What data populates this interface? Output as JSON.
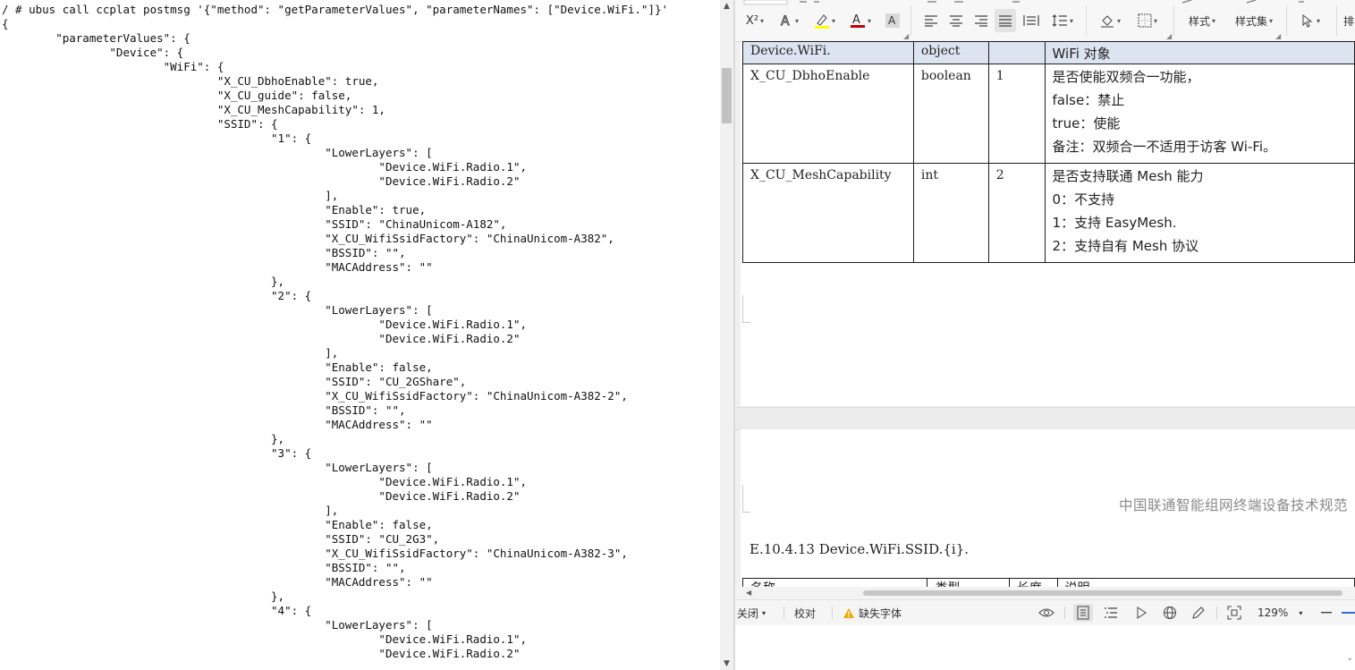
{
  "terminal": {
    "lines": [
      "/ # ubus call ccplat postmsg '{\"method\": \"getParameterValues\", \"parameterNames\": [\"Device.WiFi.\"]}'",
      "{",
      "        \"parameterValues\": {",
      "                \"Device\": {",
      "                        \"WiFi\": {",
      "                                \"X_CU_DbhoEnable\": true,",
      "                                \"X_CU_guide\": false,",
      "                                \"X_CU_MeshCapability\": 1,",
      "                                \"SSID\": {",
      "                                        \"1\": {",
      "                                                \"LowerLayers\": [",
      "                                                        \"Device.WiFi.Radio.1\",",
      "                                                        \"Device.WiFi.Radio.2\"",
      "                                                ],",
      "                                                \"Enable\": true,",
      "                                                \"SSID\": \"ChinaUnicom-A182\",",
      "                                                \"X_CU_WifiSsidFactory\": \"ChinaUnicom-A382\",",
      "                                                \"BSSID\": \"\",",
      "                                                \"MACAddress\": \"\"",
      "                                        },",
      "                                        \"2\": {",
      "                                                \"LowerLayers\": [",
      "                                                        \"Device.WiFi.Radio.1\",",
      "                                                        \"Device.WiFi.Radio.2\"",
      "                                                ],",
      "                                                \"Enable\": false,",
      "                                                \"SSID\": \"CU_2GShare\",",
      "                                                \"X_CU_WifiSsidFactory\": \"ChinaUnicom-A382-2\",",
      "                                                \"BSSID\": \"\",",
      "                                                \"MACAddress\": \"\"",
      "                                        },",
      "                                        \"3\": {",
      "                                                \"LowerLayers\": [",
      "                                                        \"Device.WiFi.Radio.1\",",
      "                                                        \"Device.WiFi.Radio.2\"",
      "                                                ],",
      "                                                \"Enable\": false,",
      "                                                \"SSID\": \"CU_2G3\",",
      "                                                \"X_CU_WifiSsidFactory\": \"ChinaUnicom-A382-3\",",
      "                                                \"BSSID\": \"\",",
      "                                                \"MACAddress\": \"\"",
      "                                        },",
      "                                        \"4\": {",
      "                                                \"LowerLayers\": [",
      "                                                        \"Device.WiFi.Radio.1\",",
      "                                                        \"Device.WiFi.Radio.2\""
    ]
  },
  "ribbon": {
    "style_label": "样式",
    "style_set_label": "样式集",
    "extra_label": "排",
    "icons": {
      "superscript": "superscript-icon",
      "text_effect": "text-effect-icon",
      "highlight": "highlight-icon",
      "font_color": "font-color-icon",
      "char_shading": "char-shading-icon",
      "align_left": "align-left-icon",
      "align_center": "align-center-icon",
      "align_right": "align-right-icon",
      "justify": "justify-icon",
      "distributed": "distributed-icon",
      "line_spacing": "line-spacing-icon",
      "shading": "shading-icon",
      "borders": "borders-icon",
      "select": "select-icon"
    },
    "font_color": "#c00000",
    "highlight_color": "#ffff00"
  },
  "document": {
    "param_table": {
      "header": {
        "name": "Device.WiFi.",
        "type": "object",
        "length": "",
        "desc": "WiFi 对象"
      },
      "rows": [
        {
          "name": "X_CU_DbhoEnable",
          "type": "boolean",
          "length": "1",
          "desc": [
            "是否使能双频合一功能，",
            "false：禁止",
            "true：使能",
            "备注：双频合一不适用于访客 Wi-Fi。"
          ]
        },
        {
          "name": "X_CU_MeshCapability",
          "type": "int",
          "length": "2",
          "desc": [
            "是否支持联通 Mesh 能力",
            "0：不支持",
            "1：支持 EasyMesh.",
            "2：支持自有 Mesh 协议"
          ]
        }
      ],
      "header_bg": "#dde4f1"
    },
    "running_header": "中国联通智能组网终端设备技术规范",
    "section_heading": "E.10.4.13 Device.WiFi.SSID.{i}.",
    "ssid_table_header": [
      "名称",
      "类型",
      "长度",
      "说明"
    ]
  },
  "statusbar": {
    "close_label": "关闭",
    "proofread_label": "校对",
    "missing_font_label": "缺失字体",
    "zoom": "129%",
    "icons": {
      "eye": "eye-icon",
      "page_view": "page-view-icon",
      "outline": "outline-icon",
      "play": "play-icon",
      "web": "globe-icon",
      "pen": "pen-icon",
      "fit": "fit-screen-icon",
      "zoom_out": "minus-icon"
    },
    "warning_color": "#f0a800"
  }
}
